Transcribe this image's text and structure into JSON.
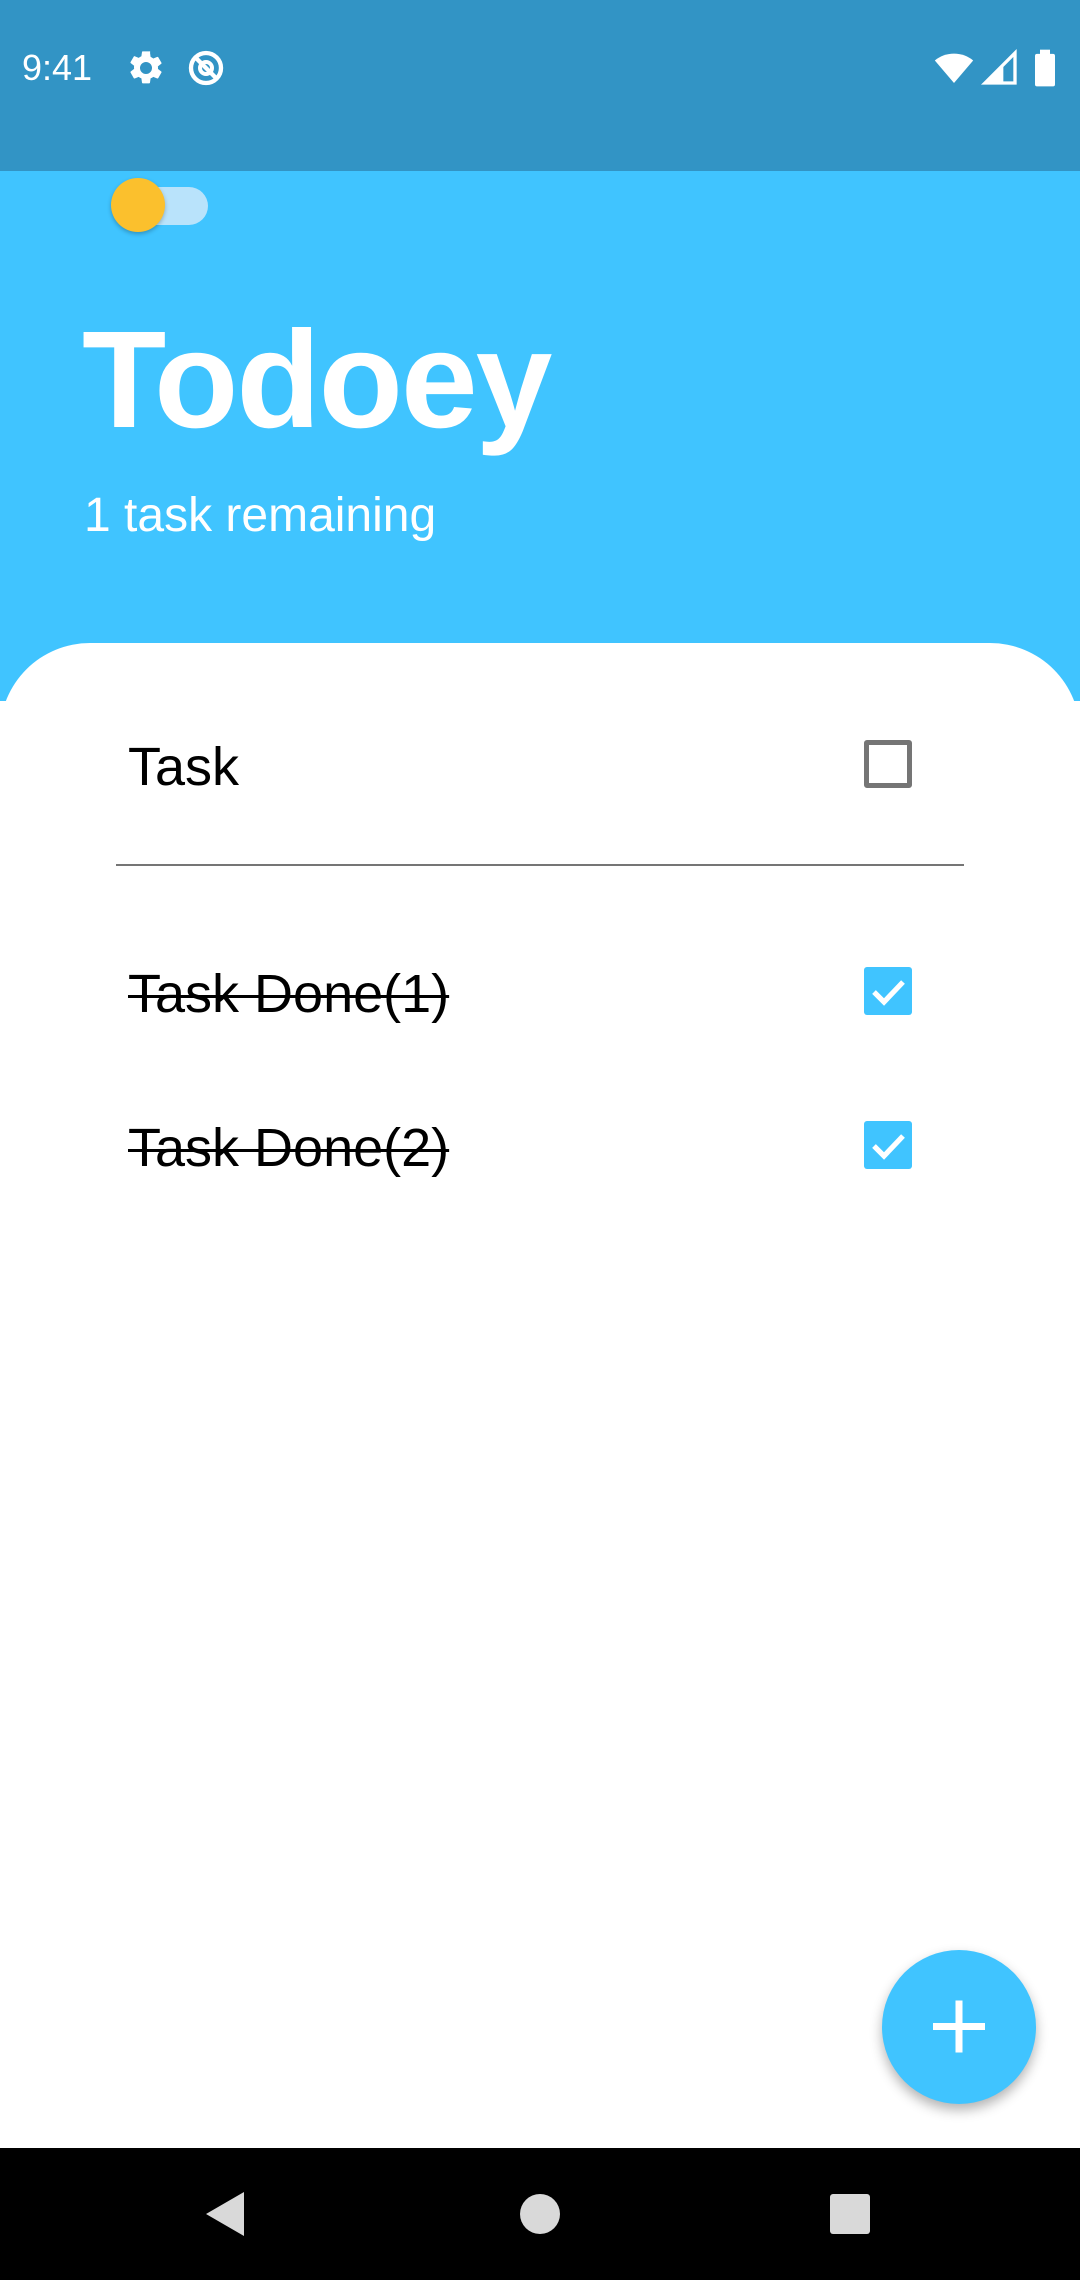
{
  "status_bar": {
    "time": "9:41",
    "icons": [
      "gear-icon",
      "no-disturb-icon",
      "wifi-icon",
      "cellular-signal-icon",
      "battery-icon"
    ],
    "background": "#3294c5"
  },
  "header": {
    "theme_toggle": {
      "state": "off",
      "knob_color": "#fbc02d"
    },
    "title": "Todoey",
    "subtitle": "1 task remaining",
    "background": "#40c4ff"
  },
  "tasks": [
    {
      "label": "Task",
      "done": false
    },
    {
      "label": "Task Done(1)",
      "done": true
    },
    {
      "label": "Task Done(2)",
      "done": true
    }
  ],
  "fab": {
    "icon": "plus-icon",
    "color": "#40c4ff"
  },
  "nav_bar": {
    "buttons": [
      "back-icon",
      "home-icon",
      "recents-icon"
    ]
  },
  "colors": {
    "accent": "#40c4ff",
    "status_bar": "#3294c5",
    "toggle_knob": "#fbc02d"
  }
}
